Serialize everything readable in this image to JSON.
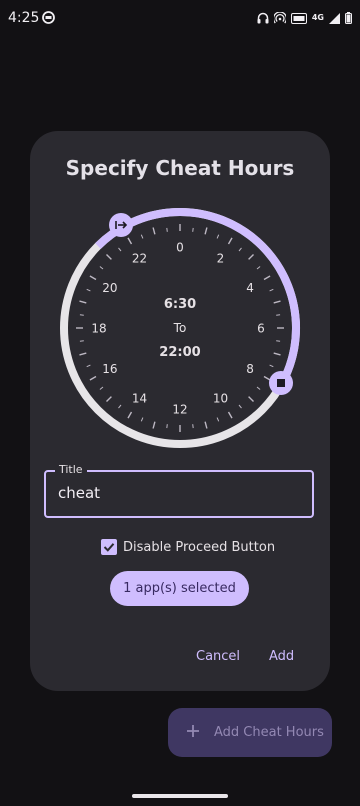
{
  "status_bar": {
    "time": "4:25",
    "network": "4G",
    "icons": [
      "media-icon",
      "headphones-icon",
      "hotspot-icon",
      "volte-icon",
      "signal-icon",
      "battery-icon"
    ]
  },
  "dialog": {
    "title": "Specify Cheat Hours",
    "clock": {
      "hour_labels": [
        "0",
        "2",
        "4",
        "6",
        "8",
        "10",
        "12",
        "14",
        "16",
        "18",
        "20",
        "22"
      ],
      "start_time": "6:30",
      "separator": "To",
      "end_time": "22:00",
      "start_icon": "arrow-to-line-icon",
      "end_icon": "stop-square-icon"
    },
    "title_field": {
      "label": "Title",
      "value": "cheat"
    },
    "checkbox": {
      "label": "Disable Proceed Button",
      "checked": true
    },
    "apps_chip": "1 app(s) selected",
    "cancel_label": "Cancel",
    "add_label": "Add"
  },
  "fab": {
    "label": "Add Cheat Hours",
    "icon": "plus-icon"
  },
  "colors": {
    "background": "#121114",
    "dialog": "#2b2a30",
    "accent": "#cfbdfe",
    "track": "#e7e5e8",
    "fab": "#3f3762"
  }
}
